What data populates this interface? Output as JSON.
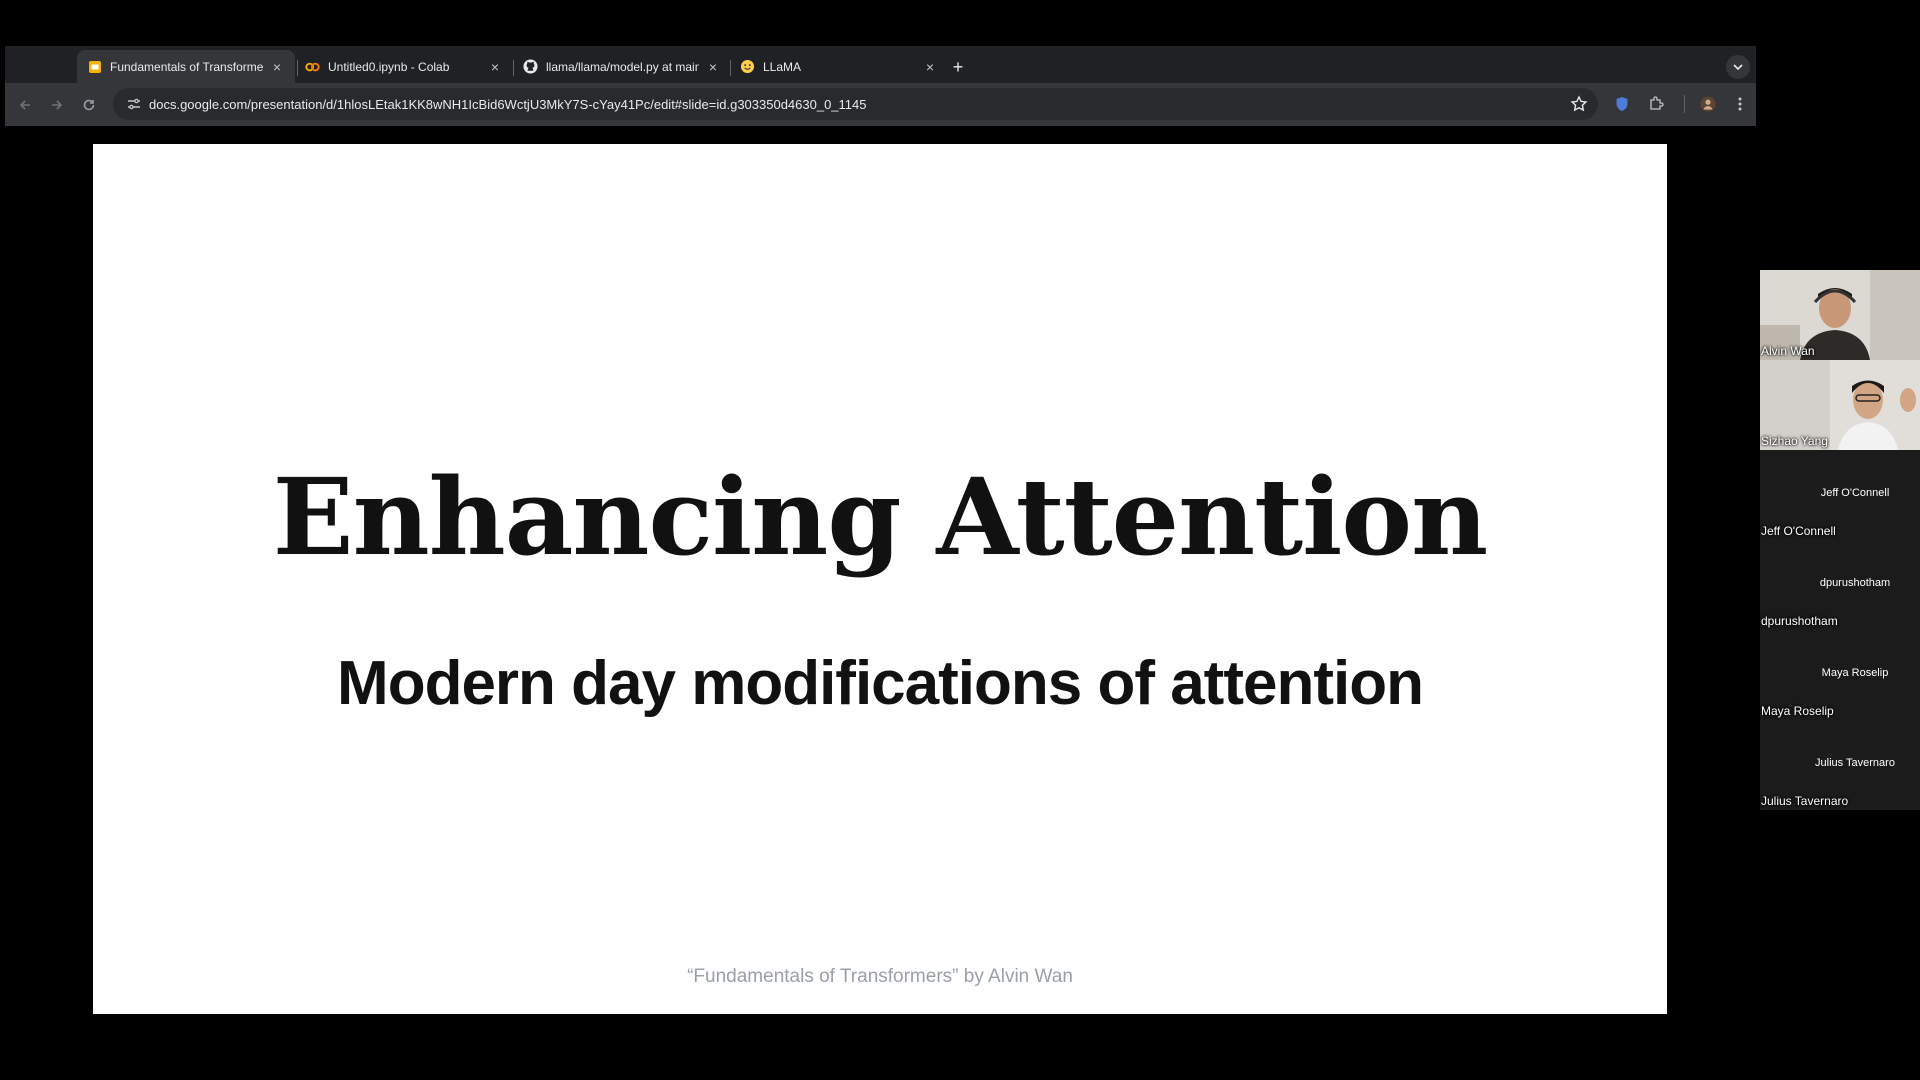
{
  "browser": {
    "tabs": [
      {
        "title": "Fundamentals of Transformers",
        "icon": "google-slides-icon",
        "active": true
      },
      {
        "title": "Untitled0.ipynb - Colab",
        "icon": "colab-icon",
        "active": false
      },
      {
        "title": "llama/llama/model.py at main",
        "icon": "github-icon",
        "active": false
      },
      {
        "title": "LLaMA",
        "icon": "hugging-face-icon",
        "active": false
      }
    ],
    "new_tab": "+",
    "close": "×",
    "url": "docs.google.com/presentation/d/1hlosLEtak1KK8wNH1IcBid6WctjU3MkY7S-cYay41Pc/edit#slide=id.g303350d4630_0_1145"
  },
  "slide": {
    "title": "Enhancing Attention",
    "subtitle": "Modern day modifications of attention",
    "footer": "“Fundamentals of Transformers” by Alvin Wan"
  },
  "participants": [
    {
      "name": "Alvin Wan",
      "video": true
    },
    {
      "name": "Sizhao Yang",
      "video": true
    },
    {
      "name": "Jeff O'Connell",
      "label": "Jeff O'Connell",
      "video": false
    },
    {
      "name": "dpurushotham",
      "label": "dpurushotham",
      "video": false
    },
    {
      "name": "Maya Roselip",
      "label": "Maya Roselip",
      "video": false
    },
    {
      "name": "Julius Tavernaro",
      "label": "Julius Tavernaro",
      "video": false
    }
  ],
  "colors": {
    "slides_yellow": "#f4b400",
    "colab_orange": "#f9ab00",
    "chrome_dark": "#202124",
    "toolbar": "#35363a"
  }
}
